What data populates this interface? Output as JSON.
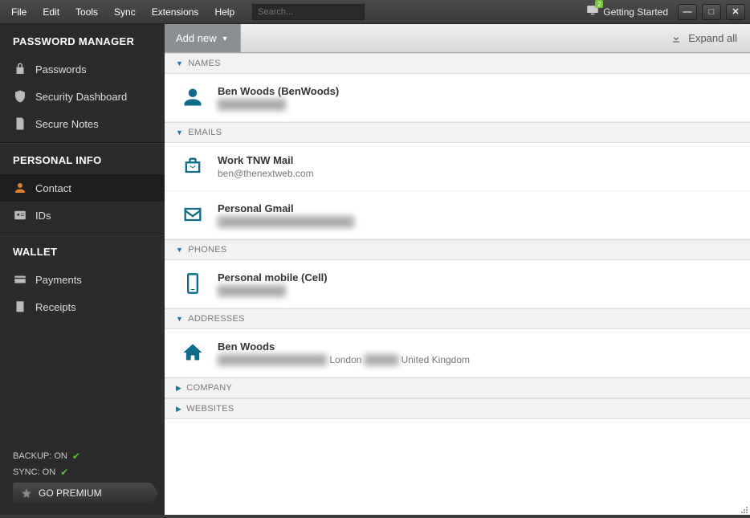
{
  "menubar": {
    "items": [
      "File",
      "Edit",
      "Tools",
      "Sync",
      "Extensions",
      "Help"
    ],
    "search_placeholder": "Search...",
    "getting_started": "Getting Started",
    "notification_count": "2"
  },
  "sidebar": {
    "groups": [
      {
        "title": "PASSWORD MANAGER",
        "items": [
          {
            "icon": "lock",
            "label": "Passwords"
          },
          {
            "icon": "shield",
            "label": "Security Dashboard"
          },
          {
            "icon": "note",
            "label": "Secure Notes"
          }
        ]
      },
      {
        "title": "PERSONAL INFO",
        "items": [
          {
            "icon": "person",
            "label": "Contact",
            "active": true
          },
          {
            "icon": "id",
            "label": "IDs"
          }
        ]
      },
      {
        "title": "WALLET",
        "items": [
          {
            "icon": "card",
            "label": "Payments"
          },
          {
            "icon": "receipt",
            "label": "Receipts"
          }
        ]
      }
    ],
    "backup_label": "BACKUP: ON",
    "sync_label": "SYNC: ON",
    "premium_label": "GO PREMIUM"
  },
  "toolbar": {
    "add_new_label": "Add new",
    "expand_label": "Expand all"
  },
  "sections": {
    "names": {
      "title": "NAMES",
      "items": [
        {
          "title": "Ben Woods (BenWoods)",
          "sub": "██████████"
        }
      ]
    },
    "emails": {
      "title": "EMAILS",
      "items": [
        {
          "icon": "briefcase",
          "title": "Work TNW Mail",
          "sub": "ben@thenextweb.com"
        },
        {
          "icon": "envelope",
          "title": "Personal Gmail",
          "sub": "████████████████████"
        }
      ]
    },
    "phones": {
      "title": "PHONES",
      "items": [
        {
          "title": "Personal mobile (Cell)",
          "sub": "██████████"
        }
      ]
    },
    "addresses": {
      "title": "ADDRESSES",
      "items": [
        {
          "title": "Ben Woods",
          "sub_parts": [
            "████████████████",
            "London",
            "█████",
            "United Kingdom"
          ]
        }
      ]
    },
    "company": {
      "title": "COMPANY"
    },
    "websites": {
      "title": "WEBSITES"
    }
  }
}
